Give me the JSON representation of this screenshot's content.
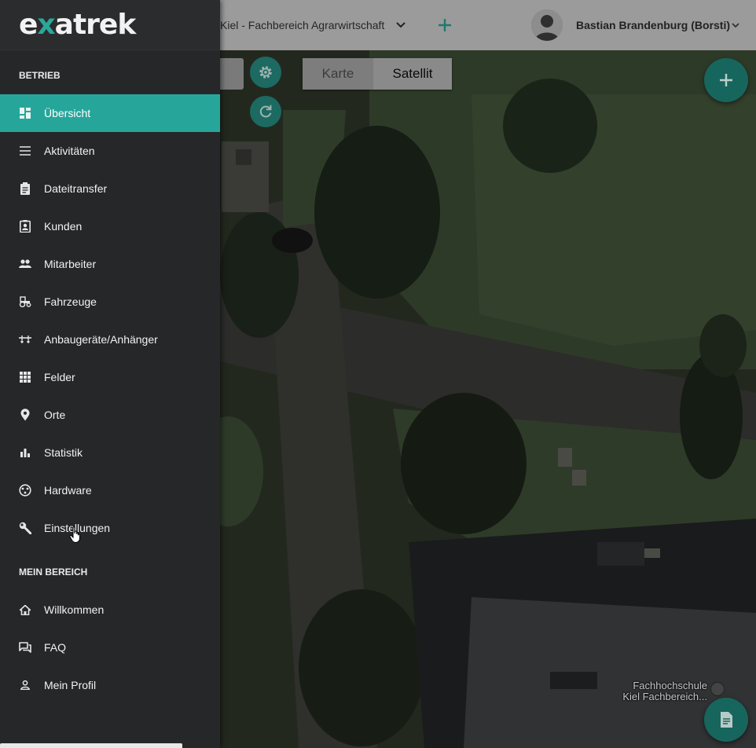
{
  "logo": {
    "prefix": "e",
    "accent": "x",
    "suffix": "atrek"
  },
  "topbar": {
    "farm_name": "Kiel - Fachbereich Agrarwirtschaft",
    "user_name": "Bastian Brandenburg (Borsti)"
  },
  "map": {
    "type_karte": "Karte",
    "type_satellit": "Satellit",
    "selected_type": "Satellit",
    "poi_line1": "Fachhochschule",
    "poi_line2": "Kiel Fachbereich..."
  },
  "sidebar": {
    "section_betrieb": "BETRIEB",
    "section_mein_bereich": "MEIN BEREICH",
    "items": [
      {
        "label": "Übersicht",
        "icon": "dashboard-icon"
      },
      {
        "label": "Aktivitäten",
        "icon": "list-icon"
      },
      {
        "label": "Dateitransfer",
        "icon": "clipboard-icon"
      },
      {
        "label": "Kunden",
        "icon": "contact-badge-icon"
      },
      {
        "label": "Mitarbeiter",
        "icon": "people-icon"
      },
      {
        "label": "Fahrzeuge",
        "icon": "tractor-icon"
      },
      {
        "label": "Anbaugeräte/Anhänger",
        "icon": "implement-icon"
      },
      {
        "label": "Felder",
        "icon": "grid-icon"
      },
      {
        "label": "Orte",
        "icon": "map-pin-icon"
      },
      {
        "label": "Statistik",
        "icon": "bar-chart-icon"
      },
      {
        "label": "Hardware",
        "icon": "chip-icon"
      },
      {
        "label": "Einstellungen",
        "icon": "wrench-icon"
      }
    ],
    "my_items": [
      {
        "label": "Willkommen",
        "icon": "home-icon"
      },
      {
        "label": "FAQ",
        "icon": "forum-icon"
      },
      {
        "label": "Mein Profil",
        "icon": "person-icon"
      }
    ],
    "active_item": "Übersicht"
  },
  "colors": {
    "accent": "#26a69a",
    "sidebar_bg": "#262729",
    "fab": "#17665d"
  }
}
